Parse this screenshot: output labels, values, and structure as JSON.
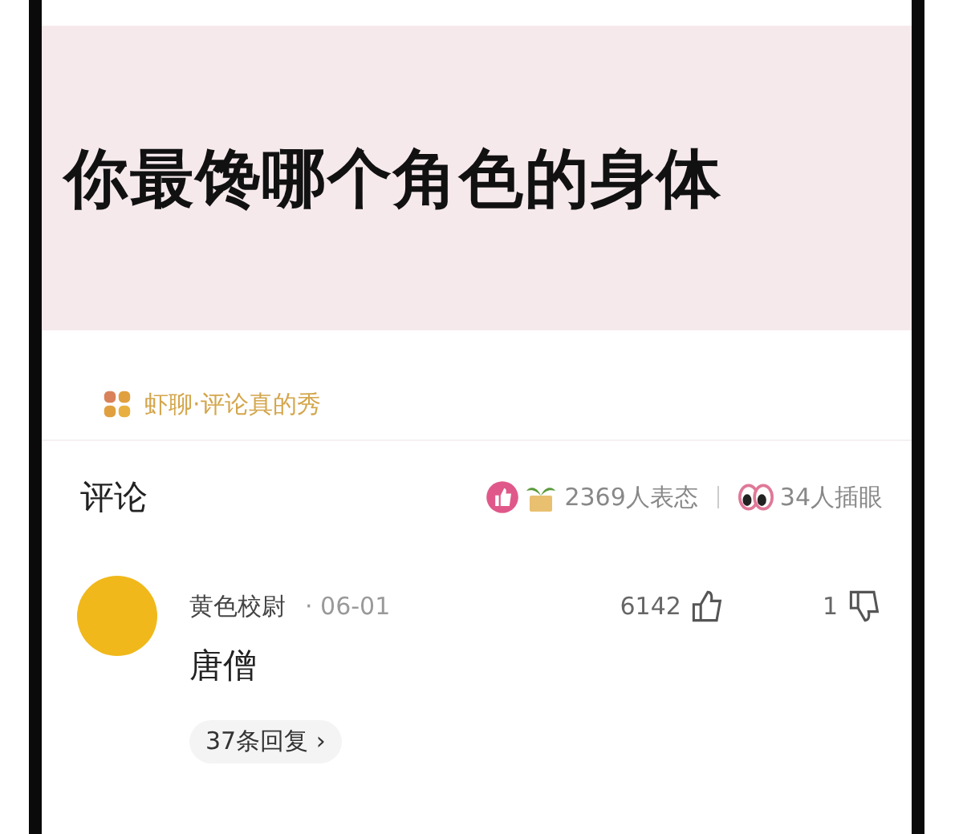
{
  "banner": {
    "title": "你最馋哪个角色的身体"
  },
  "topic": {
    "label": "虾聊·评论真的秀"
  },
  "comments_header": {
    "title": "评论",
    "reactions": "2369人表态",
    "pokes": "34人插眼"
  },
  "comments": [
    {
      "author": "黄色校尉",
      "date": "· 06-01",
      "likes": "6142",
      "dislikes": "1",
      "text": "唐僧",
      "replies": "37条回复 ›"
    }
  ]
}
